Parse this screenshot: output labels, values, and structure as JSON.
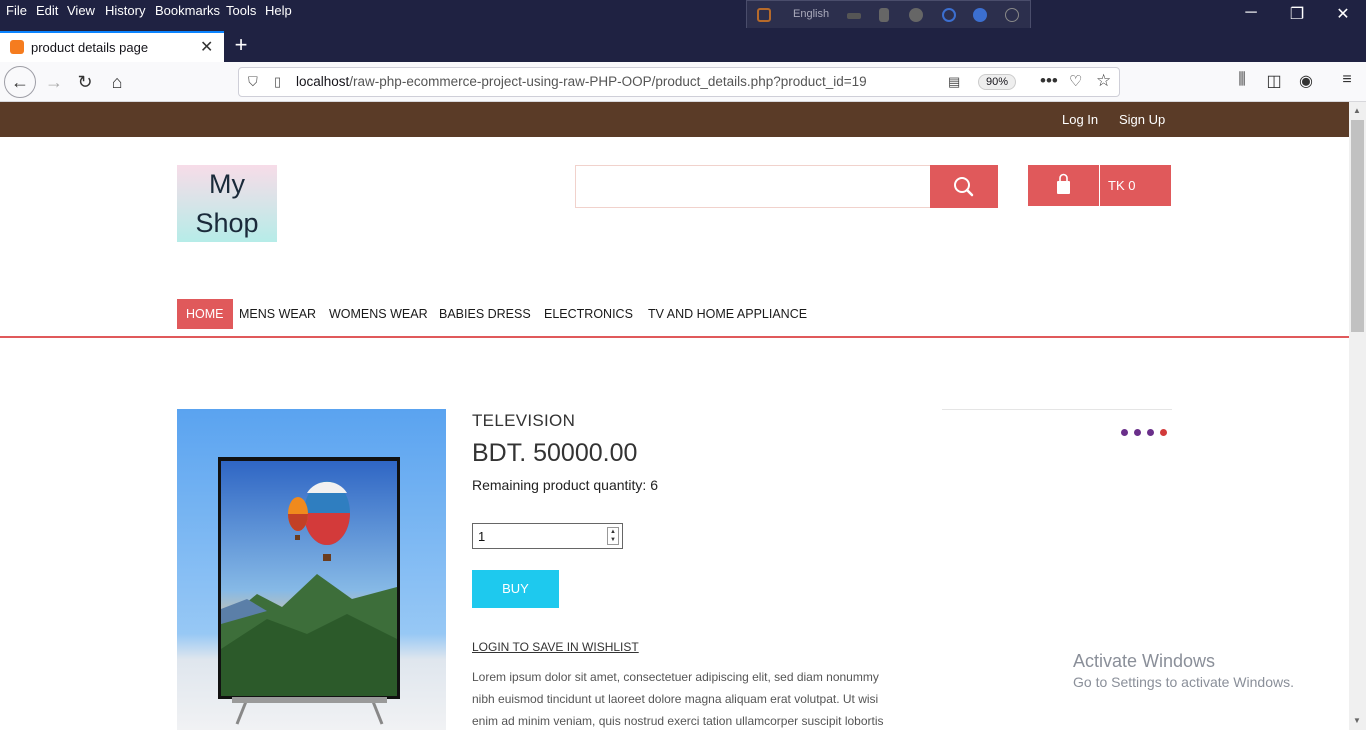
{
  "browser": {
    "menu": [
      "File",
      "Edit",
      "View",
      "History",
      "Bookmarks",
      "Tools",
      "Help"
    ],
    "extension_toolbar": {
      "language": "English"
    },
    "tab": {
      "title": "product details page",
      "close": "✕"
    },
    "new_tab": "+",
    "url": {
      "host": "localhost",
      "path": "/raw-php-ecommerce-project-using-raw-PHP-OOP/product_details.php?product_id=19"
    },
    "zoom": "90%"
  },
  "site": {
    "topbar": {
      "login": "Log In",
      "signup": "Sign Up"
    },
    "logo": {
      "line1": "My",
      "line2": "Shop"
    },
    "search": {
      "placeholder": ""
    },
    "cart": {
      "total": "TK 0"
    },
    "nav": [
      "HOME",
      "MENS WEAR",
      "WOMENS WEAR",
      "BABIES DRESS",
      "ELECTRONICS",
      "TV AND HOME APPLIANCE"
    ],
    "active_nav": "HOME"
  },
  "product": {
    "name": "TELEVISION",
    "price": "BDT. 50000.00",
    "remaining": "Remaining product quantity: 6",
    "quantity": "1",
    "buy_label": "BUY",
    "wishlist": "LOGIN TO SAVE IN WISHLIST",
    "description": [
      "Lorem ipsum dolor sit amet, consectetuer adipiscing elit, sed diam nonummy",
      "nibh euismod tincidunt ut laoreet dolore magna aliquam erat volutpat. Ut wisi",
      "enim ad minim veniam, quis nostrud exerci tation ullamcorper suscipit lobortis"
    ]
  },
  "colors": {
    "accent": "#e0595b",
    "topbar": "#5a3b27",
    "buy": "#1ec9ee",
    "chrome": "#1f2242"
  },
  "watermark": {
    "line1": "Activate Windows",
    "line2": "Go to Settings to activate Windows."
  }
}
